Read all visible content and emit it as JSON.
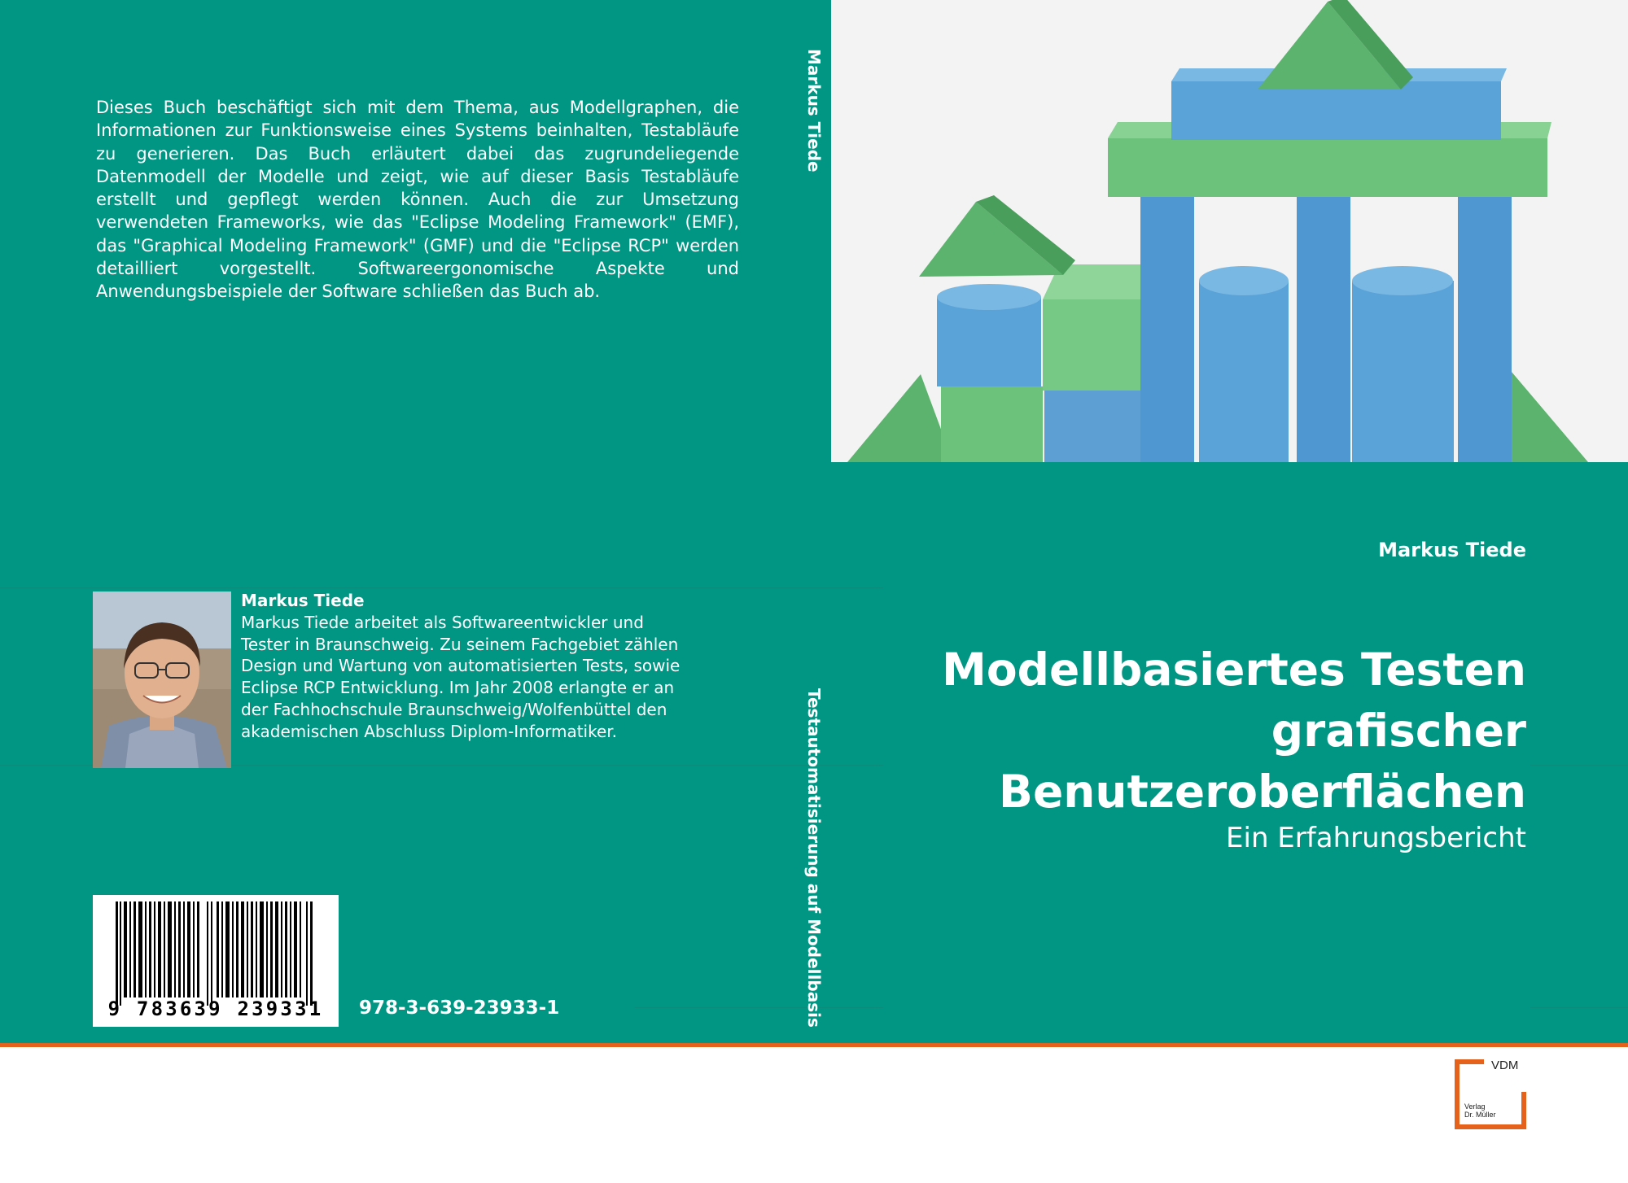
{
  "back_cover": {
    "description": "Dieses Buch beschäftigt sich mit dem Thema, aus Modellgraphen, die Informationen zur Funktionsweise eines Systems beinhalten, Testabläufe zu generieren. Das Buch erläutert dabei das zugrundeliegende Datenmodell der Modelle und zeigt, wie auf dieser Basis Testabläufe erstellt und gepflegt werden können. Auch die zur Umsetzung verwendeten Frameworks, wie das \"Eclipse Modeling Framework\" (EMF), das \"Graphical Modeling Framework\" (GMF) und die \"Eclipse RCP\" werden detailliert vorgestellt. Softwareergonomische Aspekte und Anwendungsbeispiele der Software schließen das Buch ab.",
    "author_name": "Markus Tiede",
    "author_bio": "Markus Tiede arbeitet als Softwareentwickler und Tester in Braunschweig. Zu seinem Fachgebiet zählen Design und Wartung von automatisierten Tests, sowie Eclipse RCP Entwicklung. Im Jahr 2008 erlangte er an der Fachhochschule Braunschweig/Wolfenbüttel den akademischen Abschluss Diplom-Informatiker.",
    "barcode_digits": "9 783639 239331",
    "isbn": "978-3-639-23933-1"
  },
  "spine": {
    "author": "Markus Tiede",
    "title": "Testautomatisierung auf Modellbasis"
  },
  "front_cover": {
    "author": "Markus Tiede",
    "title_lines": [
      "Modellbasiertes Testen",
      "grafischer",
      "Benutzeroberflächen"
    ],
    "subtitle": "Ein Erfahrungsbericht"
  },
  "publisher": {
    "logo_text": "VDM",
    "logo_small_1": "Verlag",
    "logo_small_2": "Dr. Müller"
  },
  "colors": {
    "cover_teal": "#009683",
    "accent_orange": "#e4621c",
    "block_blue": "#5aa3d8",
    "block_green": "#6cc27a"
  }
}
